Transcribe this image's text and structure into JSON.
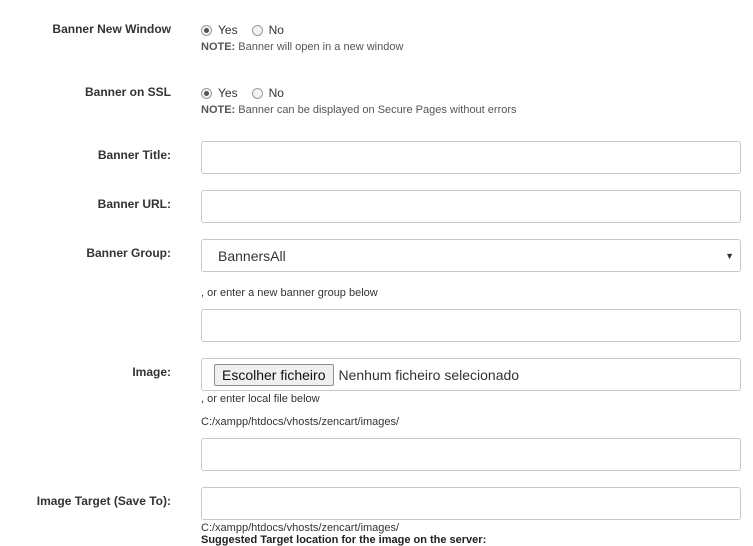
{
  "new_window": {
    "label": "Banner New Window",
    "yes": "Yes",
    "no": "No",
    "note_prefix": "NOTE:",
    "note": " Banner will open in a new window"
  },
  "ssl": {
    "label": "Banner on SSL",
    "yes": "Yes",
    "no": "No",
    "note_prefix": "NOTE:",
    "note": " Banner can be displayed on Secure Pages without errors"
  },
  "title": {
    "label": "Banner Title:",
    "value": ""
  },
  "url": {
    "label": "Banner URL:",
    "value": ""
  },
  "group": {
    "label": "Banner Group:",
    "selected": "BannersAll",
    "hint": ", or enter a new banner group below",
    "new_value": ""
  },
  "image": {
    "label": "Image:",
    "button": "Escolher ficheiro",
    "status": "Nenhum ficheiro selecionado",
    "hint": ", or enter local file below",
    "path": "C:/xampp/htdocs/vhosts/zencart/images/",
    "local_value": ""
  },
  "target": {
    "label": "Image Target (Save To):",
    "value": "",
    "path": "C:/xampp/htdocs/vhosts/zencart/images/",
    "suggested": "Suggested Target location for the image on the server:"
  }
}
